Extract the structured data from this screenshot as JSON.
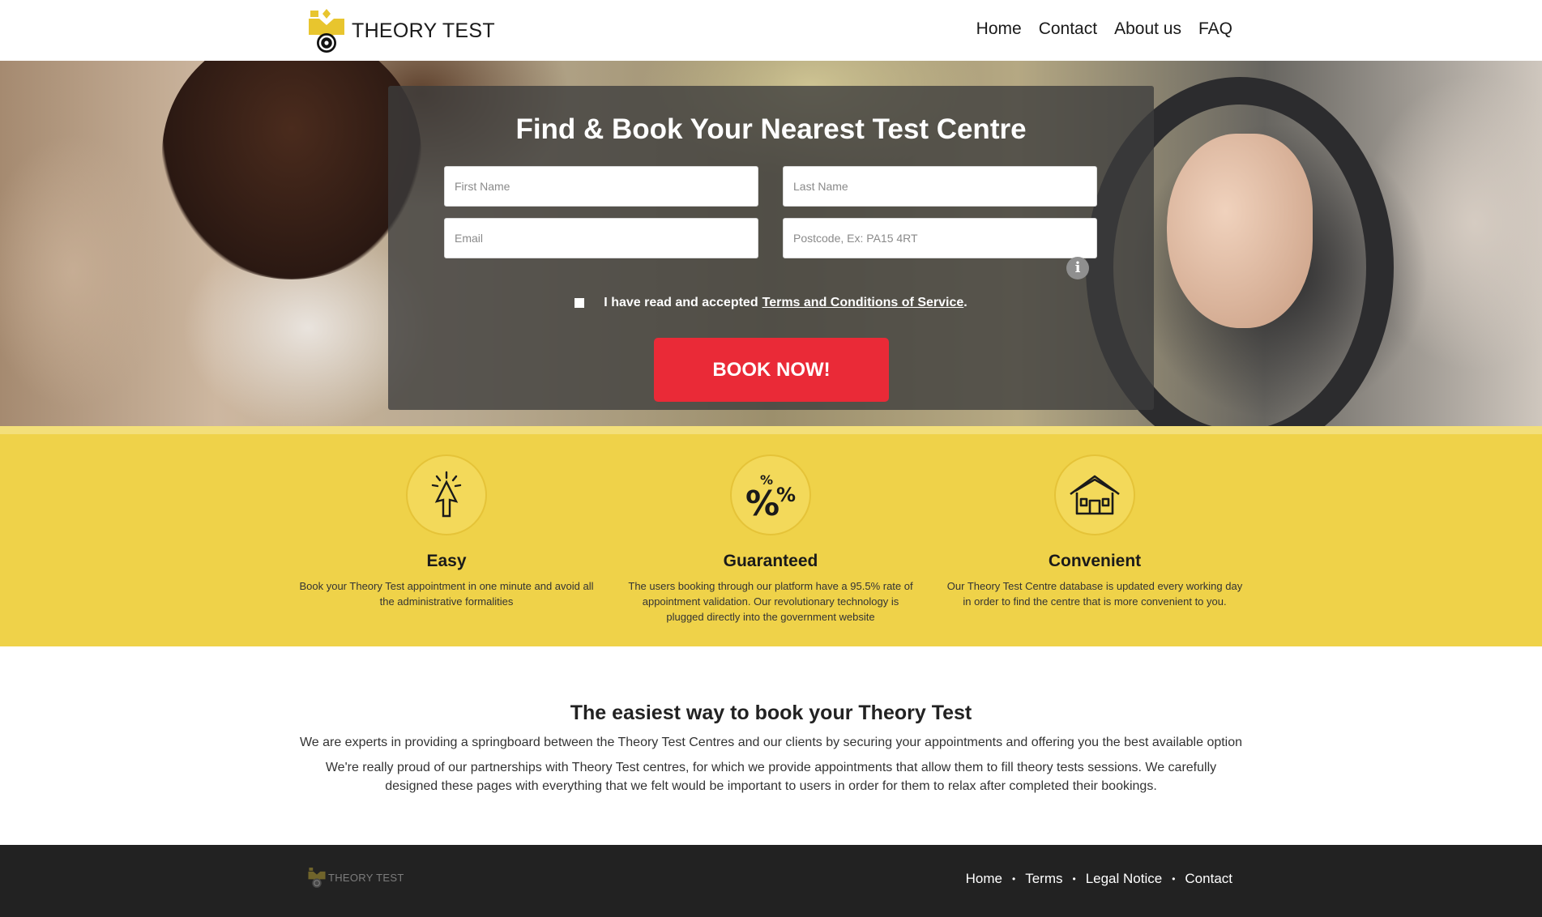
{
  "header": {
    "logo_text": "THEORY TEST",
    "nav": [
      "Home",
      "Contact",
      "About us",
      "FAQ"
    ]
  },
  "hero": {
    "title": "Find & Book Your Nearest Test Centre",
    "fields": {
      "first_name_placeholder": "First Name",
      "last_name_placeholder": "Last Name",
      "email_placeholder": "Email",
      "postcode_placeholder": "Postcode, Ex: PA15 4RT"
    },
    "terms_text": "I have read and accepted",
    "terms_link": "Terms and Conditions of Service",
    "terms_suffix": ".",
    "book_button": "BOOK NOW!",
    "icon_info": "info-icon"
  },
  "features": [
    {
      "icon": "pointer-click-icon",
      "title": "Easy",
      "text": "Book your Theory Test appointment in one minute and avoid all the administrative formalities"
    },
    {
      "icon": "percent-icon",
      "title": "Guaranteed",
      "text": "The users booking through our platform have a 95.5% rate of appointment validation. Our revolutionary technology is plugged directly into the government website"
    },
    {
      "icon": "house-icon",
      "title": "Convenient",
      "text": "Our Theory Test Centre database is updated every working day in order to find the centre that is more convenient to you."
    }
  ],
  "about": {
    "title": "The easiest way to book your Theory Test",
    "p1": "We are experts in providing a springboard between the Theory Test Centres and our clients by securing your appointments and offering you the best available option",
    "p2": "We're really proud of our partnerships with Theory Test centres, for which we provide appointments that allow them to fill theory tests sessions. We carefully designed these pages with everything that we felt would be important to users in order for them to relax after completed their bookings."
  },
  "footer": {
    "logo_text": "THEORY TEST",
    "links": [
      "Home",
      "Terms",
      "Legal Notice",
      "Contact"
    ],
    "separator": "•"
  },
  "colors": {
    "brand_yellow": "#efd249",
    "cta_red": "#ea2a37",
    "footer_bg": "#222222"
  }
}
